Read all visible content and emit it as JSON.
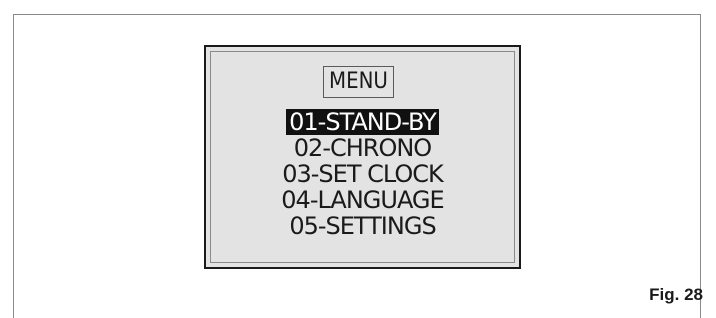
{
  "screen": {
    "title": "MENU",
    "items": [
      {
        "label": "01-STAND-BY",
        "selected": true
      },
      {
        "label": "02-CHRONO",
        "selected": false
      },
      {
        "label": "03-SET CLOCK",
        "selected": false
      },
      {
        "label": "04-LANGUAGE",
        "selected": false
      },
      {
        "label": "05-SETTINGS",
        "selected": false
      }
    ]
  },
  "figure": {
    "label": "Fig. 28"
  },
  "colors": {
    "screen_background": "#e3e3e3",
    "highlight": "#111111",
    "highlight_text": "#ffffff"
  }
}
